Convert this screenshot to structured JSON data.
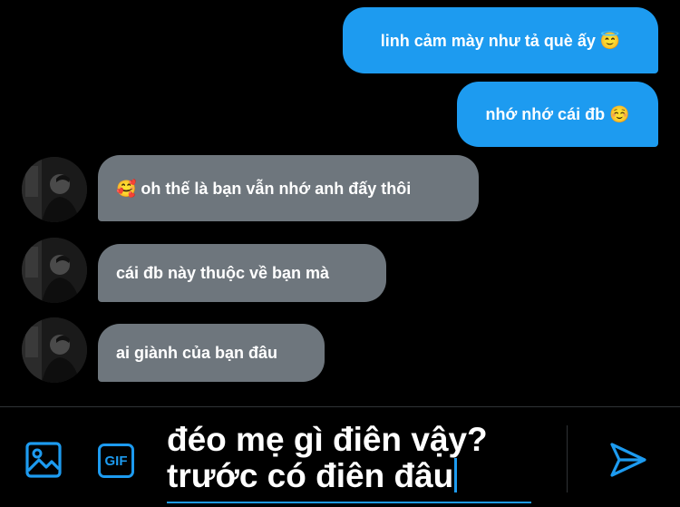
{
  "messages": [
    {
      "direction": "sent",
      "text": "linh cảm mày như tả què ấy 😇"
    },
    {
      "direction": "sent",
      "text": "nhớ nhớ cái đb ☺️"
    },
    {
      "direction": "received",
      "text": "🥰 oh thế là bạn vẫn nhớ anh đấy thôi"
    },
    {
      "direction": "received",
      "text": "cái đb này thuộc về bạn mà"
    },
    {
      "direction": "received",
      "text": "ai giành của bạn đâu"
    }
  ],
  "composer": {
    "line1": "đéo mẹ gì điên vậy?",
    "line2": "trước có điên đâu",
    "gif_label": "GIF",
    "icons": {
      "media": "image-icon",
      "gif": "gif-icon",
      "send": "send-icon"
    }
  },
  "colors": {
    "background": "#000000",
    "sent_bubble": "#1d9bf0",
    "received_bubble": "#6e767d",
    "accent": "#1d9bf0",
    "text": "#ffffff"
  }
}
